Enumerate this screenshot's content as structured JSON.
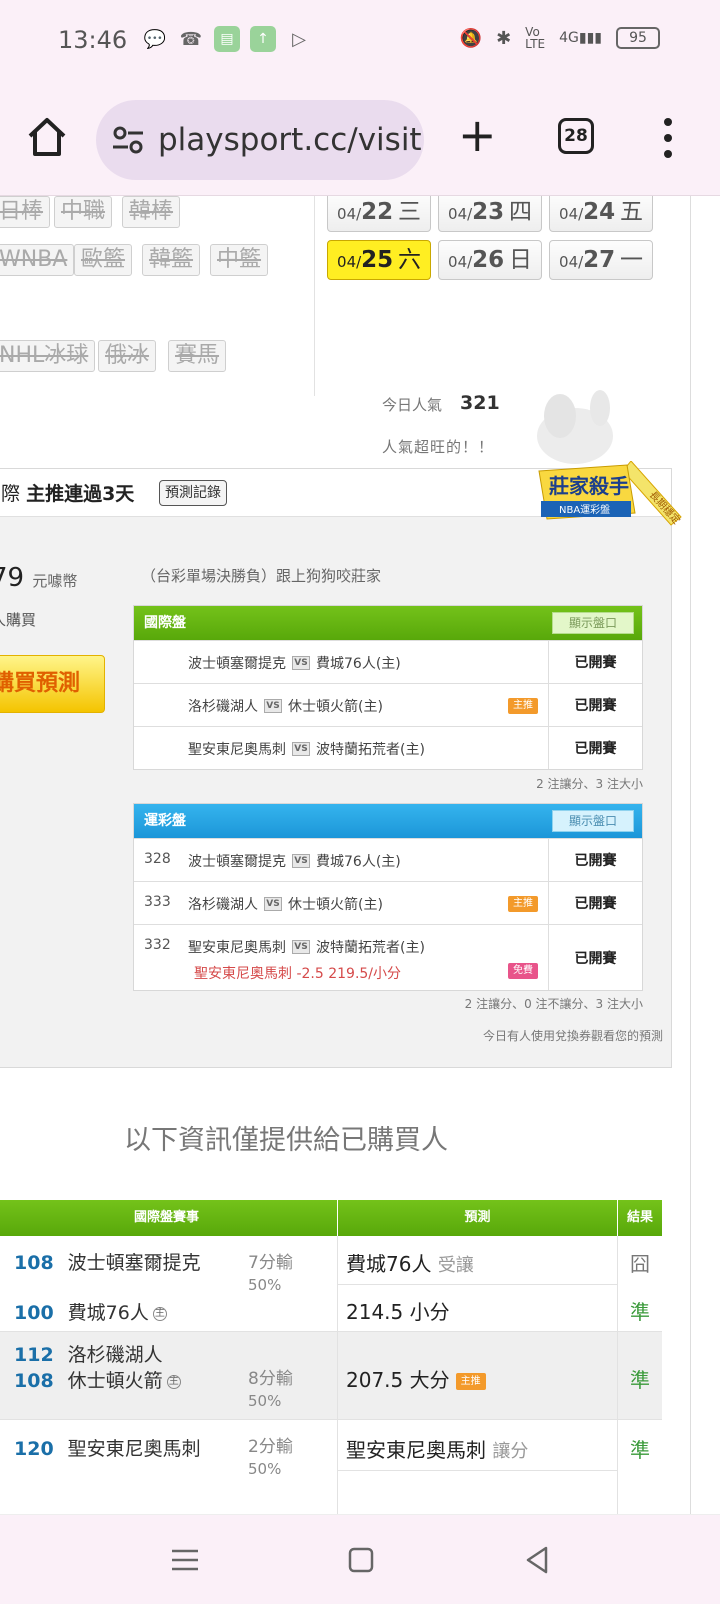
{
  "status_bar": {
    "time": "13:46",
    "battery": "95"
  },
  "browser": {
    "url": "playsport.cc/visit",
    "tab_count": "28"
  },
  "sport_tags": [
    {
      "label": "日棒"
    },
    {
      "label": "中職"
    },
    {
      "label": "韓棒"
    },
    {
      "label": "WNBA"
    },
    {
      "label": "歐籃"
    },
    {
      "label": "韓籃"
    },
    {
      "label": "中籃"
    },
    {
      "label": "NHL冰球"
    },
    {
      "label": "俄冰"
    },
    {
      "label": "賽馬"
    }
  ],
  "dates": [
    {
      "md": "04/",
      "day": "22",
      "wd": "三"
    },
    {
      "md": "04/",
      "day": "23",
      "wd": "四"
    },
    {
      "md": "04/",
      "day": "24",
      "wd": "五"
    },
    {
      "md": "04/",
      "day": "25",
      "wd": "六"
    },
    {
      "md": "04/",
      "day": "26",
      "wd": "日"
    },
    {
      "md": "04/",
      "day": "27",
      "wd": "一"
    }
  ],
  "popularity": {
    "label": "今日人氣",
    "value": "321",
    "sub": "人氣超旺的！！"
  },
  "panel": {
    "title_prefix": "際",
    "title_bold": "主推連過3天",
    "record_btn": "預測記錄",
    "badge_main": "莊家殺手",
    "badge_sub": "NBA運彩盤",
    "badge_ribbon": "長期穩定",
    "coin_value": "79",
    "coin_unit": "元噱幣",
    "buyers": "人購買",
    "buy_btn": "購買預測",
    "desc": "（台彩單場決勝負）跟上狗狗咬莊家"
  },
  "intl_table": {
    "title": "國際盤",
    "show_btn": "顯示盤口",
    "rows": [
      {
        "home": "波士頓塞爾提克",
        "vs": "VS",
        "away": "費城76人(主)",
        "status": "已開賽",
        "tag": ""
      },
      {
        "home": "洛杉磯湖人",
        "vs": "VS",
        "away": "休士頓火箭(主)",
        "status": "已開賽",
        "tag": "主推"
      },
      {
        "home": "聖安東尼奧馬刺",
        "vs": "VS",
        "away": "波特蘭拓荒者(主)",
        "status": "已開賽",
        "tag": ""
      }
    ],
    "note": "2 注讓分、3 注大小"
  },
  "lottery_table": {
    "title": "運彩盤",
    "show_btn": "顯示盤口",
    "rows": [
      {
        "num": "328",
        "home": "波士頓塞爾提克",
        "vs": "VS",
        "away": "費城76人(主)",
        "status": "已開賽",
        "tag": ""
      },
      {
        "num": "333",
        "home": "洛杉磯湖人",
        "vs": "VS",
        "away": "休士頓火箭(主)",
        "status": "已開賽",
        "tag": "主推"
      },
      {
        "num": "332",
        "home": "聖安東尼奧馬刺",
        "vs": "VS",
        "away": "波特蘭拓荒者(主)",
        "status": "已開賽",
        "tag": "免費",
        "sub": "聖安東尼奧馬刺 -2.5 219.5/小分"
      }
    ],
    "note": "2 注讓分、0 注不讓分、3 注大小",
    "note2": "今日有人使用兌換券觀看您的預測"
  },
  "info_title": "以下資訊僅提供給已購買人",
  "bottom_table": {
    "headers": {
      "game": "國際盤賽事",
      "pred": "預測",
      "result": "結果"
    },
    "games": [
      {
        "t1_num": "108",
        "t1_name": "波士頓塞爾提克",
        "t2_num": "100",
        "t2_name": "費城76人",
        "host": "主",
        "hc_line": "7分輸",
        "hc_pct": "50%",
        "pred1": "費城76人",
        "pred1_note": "受讓",
        "res1": "囧",
        "pred2": "214.5 小分",
        "res2": "準"
      },
      {
        "t1_num": "112",
        "t1_name": "洛杉磯湖人",
        "t2_num": "108",
        "t2_name": "休士頓火箭",
        "host": "主",
        "hc_line": "8分輸",
        "hc_pct": "50%",
        "pred1": "207.5 大分",
        "pred1_tag": "主推",
        "res1": "準"
      },
      {
        "t1_num": "120",
        "t1_name": "聖安東尼奧馬刺",
        "hc_line": "2分輸",
        "hc_pct": "50%",
        "pred1": "聖安東尼奧馬刺",
        "pred1_note": "讓分",
        "res1": "準"
      }
    ]
  }
}
